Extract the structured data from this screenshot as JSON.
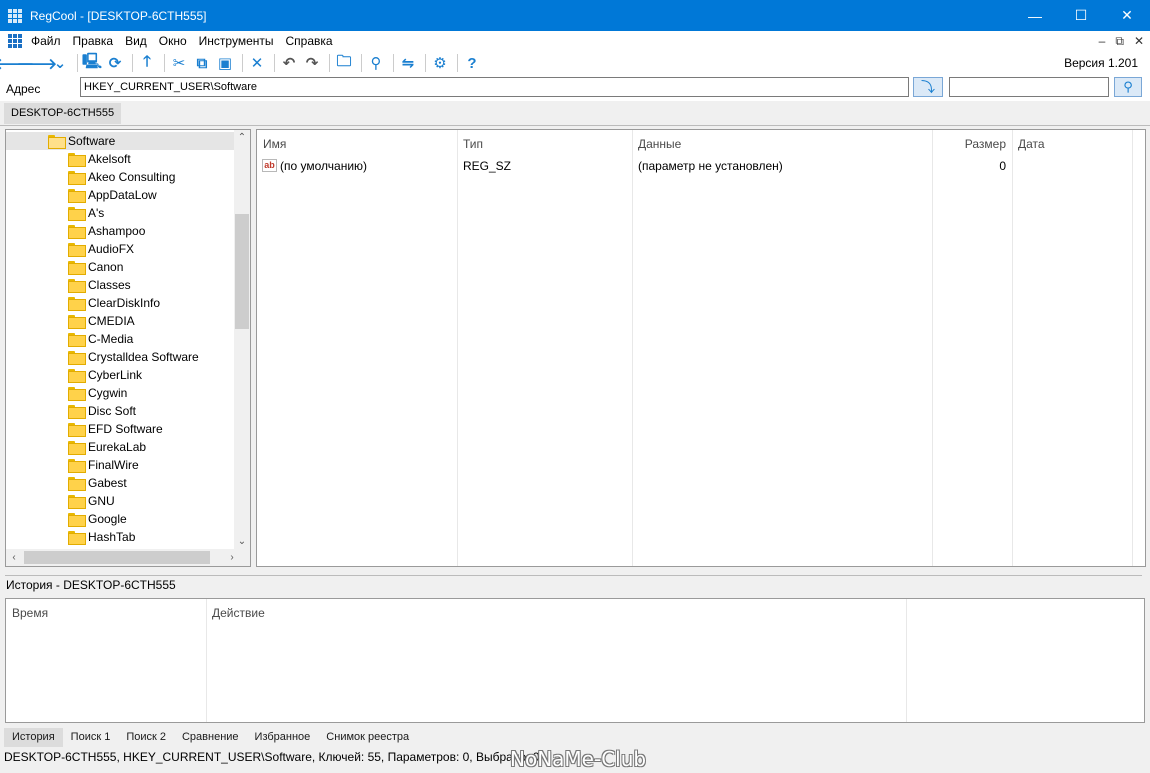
{
  "titlebar": {
    "title": "RegCool - [DESKTOP-6CTH555]",
    "buttons": {
      "minimize": "—",
      "maximize": "☐",
      "close": "✕"
    }
  },
  "menu": {
    "items": [
      "Файл",
      "Правка",
      "Вид",
      "Окно",
      "Инструменты",
      "Справка"
    ],
    "mdi_controls": [
      "–",
      "⧉",
      "✕"
    ]
  },
  "toolbar": {
    "icons": [
      "back-arrow-icon",
      "forward-arrow-icon",
      "dropdown-arrow-icon",
      "computer-icon",
      "network-icon",
      "up-arrow-icon",
      "cut-icon",
      "copy-icon",
      "paste-icon",
      "delete-icon",
      "undo-icon",
      "redo-icon",
      "new-key-icon",
      "find-icon",
      "refresh-icon",
      "settings-icon",
      "help-icon"
    ],
    "version": "Версия 1.201"
  },
  "address": {
    "label": "Адрес",
    "value": "HKEY_CURRENT_USER\\Software",
    "search_value": ""
  },
  "document_tab": "DESKTOP-6CTH555",
  "tree": {
    "items": [
      {
        "label": "Software",
        "open": true,
        "selected": true
      },
      {
        "label": "Akelsoft"
      },
      {
        "label": "Akeo Consulting"
      },
      {
        "label": "AppDataLow"
      },
      {
        "label": "A's"
      },
      {
        "label": "Ashampoo"
      },
      {
        "label": "AudioFX"
      },
      {
        "label": "Canon"
      },
      {
        "label": "Classes"
      },
      {
        "label": "ClearDiskInfo"
      },
      {
        "label": "CMEDIA"
      },
      {
        "label": "C-Media"
      },
      {
        "label": "Crystalldea Software"
      },
      {
        "label": "CyberLink"
      },
      {
        "label": "Cygwin"
      },
      {
        "label": "Disc Soft"
      },
      {
        "label": "EFD Software"
      },
      {
        "label": "EurekaLab"
      },
      {
        "label": "FinalWire"
      },
      {
        "label": "Gabest"
      },
      {
        "label": "GNU"
      },
      {
        "label": "Google"
      },
      {
        "label": "HashTab"
      }
    ]
  },
  "values": {
    "columns": {
      "name": "Имя",
      "type": "Тип",
      "data": "Данные",
      "size": "Размер",
      "date": "Дата"
    },
    "rows": [
      {
        "icon": "ab",
        "name": "(по умолчанию)",
        "type": "REG_SZ",
        "data": "(параметр не установлен)",
        "size": "0",
        "date": ""
      }
    ]
  },
  "history": {
    "title": "История - DESKTOP-6CTH555",
    "columns": {
      "time": "Время",
      "action": "Действие"
    }
  },
  "bottom_tabs": [
    "История",
    "Поиск 1",
    "Поиск 2",
    "Сравнение",
    "Избранное",
    "Снимок реестра"
  ],
  "status": {
    "text": "DESKTOP-6CTH555, HKEY_CURRENT_USER\\Software, Ключей: 55, Параметров: 0, Выбрано: 0",
    "watermark": "NoNaMe-Club"
  }
}
